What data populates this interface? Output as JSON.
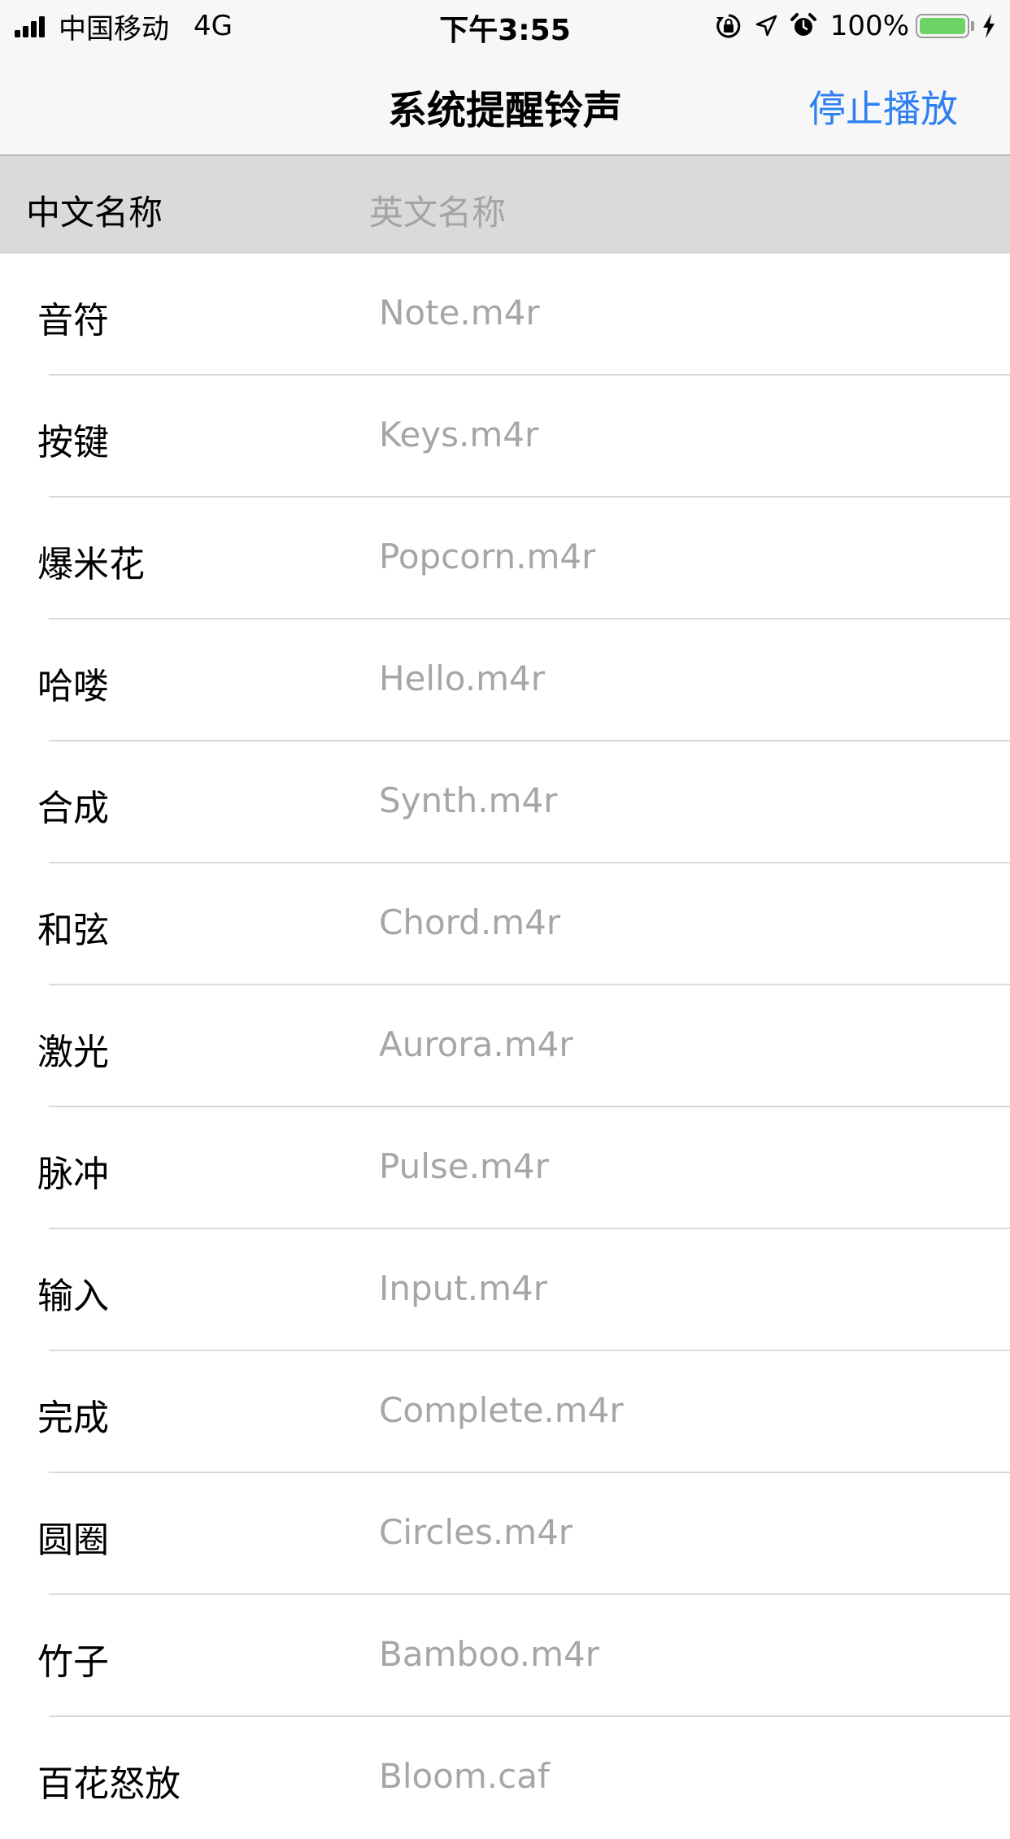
{
  "status_bar": {
    "carrier": "中国移动",
    "network": "4G",
    "time": "下午3:55",
    "battery_percent": "100%",
    "battery_level": 1.0,
    "icons": [
      "signal-icon",
      "rotation-lock-icon",
      "location-icon",
      "alarm-icon",
      "battery-icon",
      "charging-icon"
    ]
  },
  "nav": {
    "title": "系统提醒铃声",
    "action_label": "停止播放",
    "accent_color": "#2f7ff2"
  },
  "table_header": {
    "chinese_name": "中文名称",
    "english_name": "英文名称"
  },
  "rows": [
    {
      "zh": "音符",
      "en": "Note.m4r"
    },
    {
      "zh": "按键",
      "en": "Keys.m4r"
    },
    {
      "zh": "爆米花",
      "en": "Popcorn.m4r"
    },
    {
      "zh": "哈喽",
      "en": "Hello.m4r"
    },
    {
      "zh": "合成",
      "en": "Synth.m4r"
    },
    {
      "zh": "和弦",
      "en": "Chord.m4r"
    },
    {
      "zh": "激光",
      "en": "Aurora.m4r"
    },
    {
      "zh": "脉冲",
      "en": "Pulse.m4r"
    },
    {
      "zh": "输入",
      "en": "Input.m4r"
    },
    {
      "zh": "完成",
      "en": "Complete.m4r"
    },
    {
      "zh": "圆圈",
      "en": "Circles.m4r"
    },
    {
      "zh": "竹子",
      "en": "Bamboo.m4r"
    },
    {
      "zh": "百花怒放",
      "en": "Bloom.caf"
    }
  ]
}
